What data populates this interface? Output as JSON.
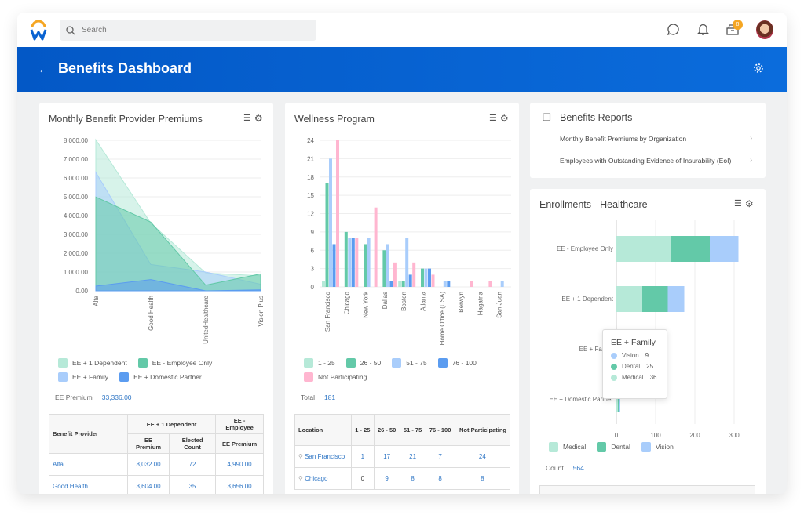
{
  "topbar": {
    "search_placeholder": "Search",
    "notification_count": "8"
  },
  "header": {
    "title": "Benefits Dashboard"
  },
  "colors": {
    "mint": "#b6e9d8",
    "green": "#63c9a8",
    "lightblue": "#a9cdfb",
    "blue": "#5b9cf0",
    "pink": "#ffb6d0",
    "brand": "#0a63d1"
  },
  "premiums": {
    "title": "Monthly Benefit Provider Premiums",
    "legend": [
      "EE + 1 Dependent",
      "EE - Employee Only",
      "EE + Family",
      "EE + Domestic Partner"
    ],
    "metric_label": "EE Premium",
    "metric_value": "33,336.00",
    "table": {
      "col_provider": "Benefit Provider",
      "group1": "EE + 1 Dependent",
      "group2": "EE - Employee",
      "sub1": "EE Premium",
      "sub2": "Elected Count",
      "sub3": "EE Premium",
      "rows": [
        [
          "Alta",
          "8,032.00",
          "72",
          "4,990.00"
        ],
        [
          "Good Health",
          "3,604.00",
          "35",
          "3,656.00"
        ]
      ]
    }
  },
  "wellness": {
    "title": "Wellness Program",
    "legend": [
      "1 - 25",
      "26 - 50",
      "51 - 75",
      "76 - 100",
      "Not Participating"
    ],
    "metric_label": "Total",
    "metric_value": "181",
    "table": {
      "headers": [
        "Location",
        "1 - 25",
        "26 - 50",
        "51 - 75",
        "76 - 100",
        "Not Participating"
      ],
      "rows": [
        [
          "San Francisco",
          "1",
          "17",
          "21",
          "7",
          "24"
        ],
        [
          "Chicago",
          "0",
          "9",
          "8",
          "8",
          "8"
        ]
      ]
    }
  },
  "reports": {
    "title": "Benefits Reports",
    "items": [
      "Monthly Benefit Premiums by Organization",
      "Employees with Outstanding Evidence of Insurability (EoI)"
    ]
  },
  "enrollments": {
    "title": "Enrollments - Healthcare",
    "legend": [
      "Medical",
      "Dental",
      "Vision"
    ],
    "metric_label": "Count",
    "metric_value": "564",
    "tooltip": {
      "title": "EE + Family",
      "rows": [
        [
          "Vision",
          "9"
        ],
        [
          "Dental",
          "25"
        ],
        [
          "Medical",
          "36"
        ]
      ]
    }
  },
  "chart_data": [
    {
      "type": "area",
      "title": "Monthly Benefit Provider Premiums",
      "categories": [
        "Alta",
        "Good Health",
        "UnitedHealthcare",
        "Vision Plus"
      ],
      "ylim": [
        0,
        8000
      ],
      "yticks": [
        "0.00",
        "1,000.00",
        "2,000.00",
        "3,000.00",
        "4,000.00",
        "5,000.00",
        "6,000.00",
        "7,000.00",
        "8,000.00"
      ],
      "series": [
        {
          "name": "EE + 1 Dependent",
          "values": [
            8032,
            3604,
            950,
            800
          ]
        },
        {
          "name": "EE - Employee Only",
          "values": [
            4990,
            3656,
            300,
            900
          ]
        },
        {
          "name": "EE + Family",
          "values": [
            6300,
            1400,
            1000,
            350
          ]
        },
        {
          "name": "EE + Domestic Partner",
          "values": [
            250,
            600,
            0,
            50
          ]
        }
      ]
    },
    {
      "type": "bar",
      "title": "Wellness Program",
      "categories": [
        "San Francisco",
        "Chicago",
        "New York",
        "Dallas",
        "Boston",
        "Atlanta",
        "Home Office (USA)",
        "Berwyn",
        "Hagatna",
        "San Juan"
      ],
      "ylim": [
        0,
        24
      ],
      "yticks": [
        "0",
        "3",
        "6",
        "9",
        "12",
        "15",
        "18",
        "21",
        "24"
      ],
      "series": [
        {
          "name": "1 - 25",
          "values": [
            1,
            0,
            0,
            0,
            1,
            0,
            0,
            0,
            0,
            0
          ]
        },
        {
          "name": "26 - 50",
          "values": [
            17,
            9,
            7,
            6,
            1,
            3,
            0,
            0,
            0,
            0
          ]
        },
        {
          "name": "51 - 75",
          "values": [
            21,
            8,
            8,
            7,
            8,
            3,
            1,
            0,
            0,
            1
          ]
        },
        {
          "name": "76 - 100",
          "values": [
            7,
            8,
            0,
            1,
            2,
            3,
            1,
            0,
            0,
            0
          ]
        },
        {
          "name": "Not Participating",
          "values": [
            24,
            8,
            13,
            4,
            4,
            2,
            0,
            1,
            1,
            0
          ]
        }
      ]
    },
    {
      "type": "bar",
      "orientation": "horizontal",
      "stacked": true,
      "title": "Enrollments - Healthcare",
      "categories": [
        "EE - Employee Only",
        "EE + 1 Dependent",
        "EE + Family",
        "EE + Domestic Partner"
      ],
      "xlim": [
        0,
        300
      ],
      "xticks": [
        "0",
        "100",
        "200",
        "300"
      ],
      "series": [
        {
          "name": "Medical",
          "values": [
            138,
            66,
            36,
            4
          ]
        },
        {
          "name": "Dental",
          "values": [
            100,
            65,
            25,
            4
          ]
        },
        {
          "name": "Vision",
          "values": [
            73,
            42,
            9,
            2
          ]
        }
      ]
    }
  ]
}
